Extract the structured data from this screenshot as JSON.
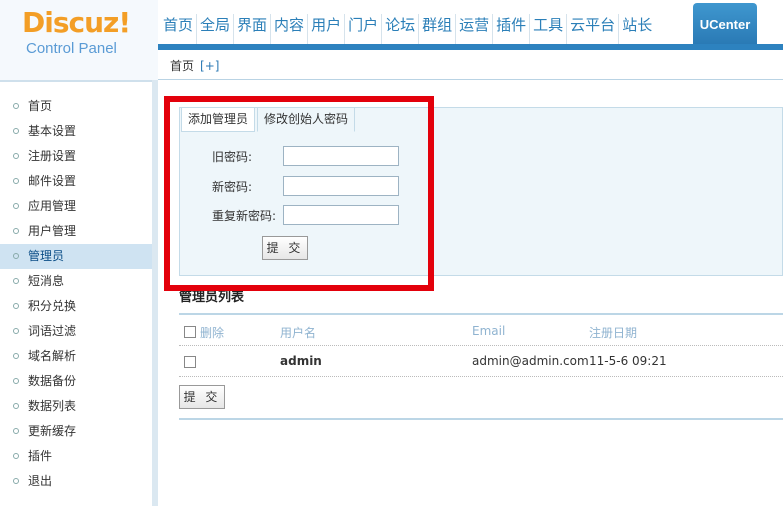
{
  "logo": {
    "brand": "Discuz!",
    "sub": "Control Panel"
  },
  "topnav": {
    "items": [
      "首页",
      "全局",
      "界面",
      "内容",
      "用户",
      "门户",
      "论坛",
      "群组",
      "运营",
      "插件",
      "工具",
      "云平台",
      "站长"
    ],
    "ucenter": "UCenter"
  },
  "breadcrumb": {
    "home": "首页",
    "add": "[+]"
  },
  "sidebar": {
    "items": [
      "首页",
      "基本设置",
      "注册设置",
      "邮件设置",
      "应用管理",
      "用户管理",
      "管理员",
      "短消息",
      "积分兑换",
      "词语过滤",
      "域名解析",
      "数据备份",
      "数据列表",
      "更新缓存",
      "插件",
      "退出"
    ],
    "active_index": 6
  },
  "tabs": {
    "add_admin": "添加管理员",
    "change_password": "修改创始人密码"
  },
  "password_form": {
    "old_label": "旧密码:",
    "new_label": "新密码:",
    "repeat_label": "重复新密码:",
    "old_value": "",
    "new_value": "",
    "repeat_value": "",
    "submit": "提 交"
  },
  "admin_list": {
    "title": "管理员列表",
    "columns": {
      "delete": "删除",
      "username": "用户名",
      "email": "Email",
      "regdate": "注册日期"
    },
    "rows": [
      {
        "username": "admin",
        "email": "admin@admin.com",
        "regdate": "11-5-6 09:21"
      }
    ],
    "submit": "提 交"
  },
  "colors": {
    "accent": "#2d82bf",
    "logo": "#f39e26",
    "highlight_box": "#e3000b"
  }
}
